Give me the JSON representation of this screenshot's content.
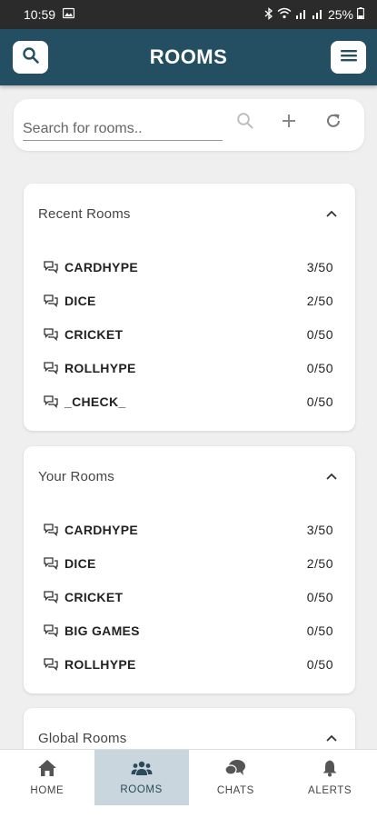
{
  "status_bar": {
    "time": "10:59",
    "battery": "25%"
  },
  "app_bar": {
    "title": "ROOMS"
  },
  "search": {
    "placeholder": "Search for rooms.."
  },
  "sections": [
    {
      "label": "Recent Rooms",
      "rooms": [
        {
          "name": "CARDHYPE",
          "count": "3/50"
        },
        {
          "name": "DICE",
          "count": "2/50"
        },
        {
          "name": "CRICKET",
          "count": "0/50"
        },
        {
          "name": "ROLLHYPE",
          "count": "0/50"
        },
        {
          "name": "_CHECK_",
          "count": "0/50"
        }
      ]
    },
    {
      "label": "Your Rooms",
      "rooms": [
        {
          "name": "CARDHYPE",
          "count": "3/50"
        },
        {
          "name": "DICE",
          "count": "2/50"
        },
        {
          "name": "CRICKET",
          "count": "0/50"
        },
        {
          "name": "BIG GAMES",
          "count": "0/50"
        },
        {
          "name": "ROLLHYPE",
          "count": "0/50"
        }
      ]
    },
    {
      "label": "Global Rooms",
      "rooms": []
    }
  ],
  "bottom_nav": [
    {
      "label": "HOME",
      "icon": "home-icon"
    },
    {
      "label": "ROOMS",
      "icon": "groups-icon",
      "active": true
    },
    {
      "label": "CHATS",
      "icon": "chat-bubbles-icon"
    },
    {
      "label": "ALERTS",
      "icon": "bell-icon"
    }
  ],
  "colors": {
    "app_bar": "#244f63",
    "active_tab": "#c9d6dd",
    "background": "#efefef"
  }
}
